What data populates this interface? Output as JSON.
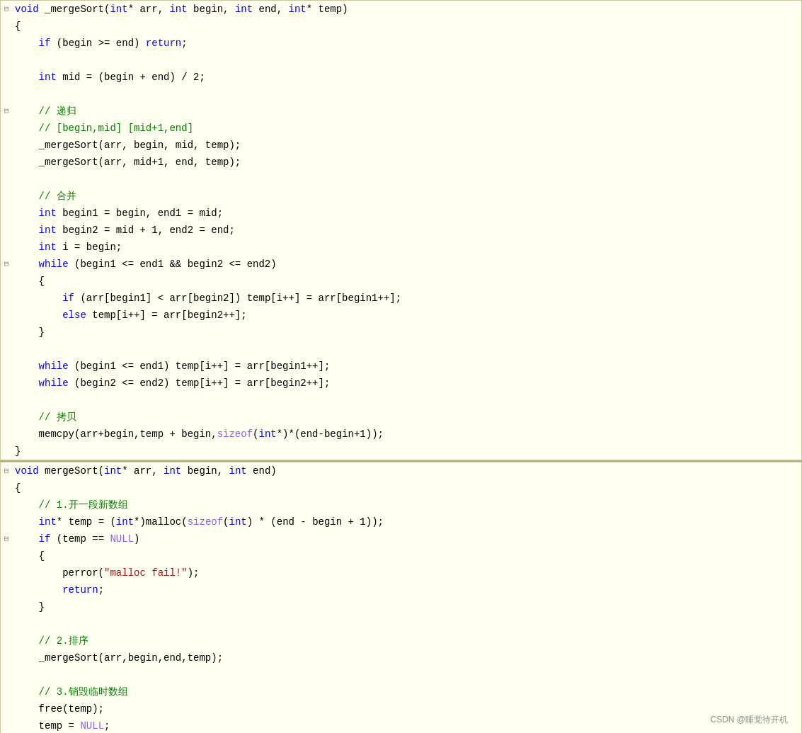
{
  "watermark": "CSDN @睡觉待开机",
  "blocks": [
    {
      "id": "block1",
      "lines": [
        {
          "fold": "⊟",
          "tokens": [
            {
              "t": "kw",
              "v": "void"
            },
            {
              "t": "plain",
              "v": " _mergeSort("
            },
            {
              "t": "kw",
              "v": "int"
            },
            {
              "t": "plain",
              "v": "* arr, "
            },
            {
              "t": "kw",
              "v": "int"
            },
            {
              "t": "plain",
              "v": " begin, "
            },
            {
              "t": "kw",
              "v": "int"
            },
            {
              "t": "plain",
              "v": " end, "
            },
            {
              "t": "kw",
              "v": "int"
            },
            {
              "t": "plain",
              "v": "* temp)"
            }
          ]
        },
        {
          "fold": "",
          "tokens": [
            {
              "t": "plain",
              "v": "{"
            }
          ]
        },
        {
          "fold": "",
          "tokens": [
            {
              "t": "plain",
              "v": "    "
            },
            {
              "t": "kw",
              "v": "if"
            },
            {
              "t": "plain",
              "v": " (begin >= end) "
            },
            {
              "t": "kw",
              "v": "return"
            },
            {
              "t": "plain",
              "v": ";"
            }
          ]
        },
        {
          "fold": "",
          "tokens": []
        },
        {
          "fold": "",
          "tokens": [
            {
              "t": "plain",
              "v": "    "
            },
            {
              "t": "kw",
              "v": "int"
            },
            {
              "t": "plain",
              "v": " mid = (begin + end) / 2;"
            }
          ]
        },
        {
          "fold": "",
          "tokens": []
        },
        {
          "fold": "⊟",
          "tokens": [
            {
              "t": "plain",
              "v": "    "
            },
            {
              "t": "cn",
              "v": "// 递归"
            }
          ]
        },
        {
          "fold": "",
          "tokens": [
            {
              "t": "plain",
              "v": "    "
            },
            {
              "t": "cn",
              "v": "// [begin,mid] [mid+1,end]"
            }
          ]
        },
        {
          "fold": "",
          "tokens": [
            {
              "t": "plain",
              "v": "    _mergeSort(arr, begin, mid, temp);"
            }
          ]
        },
        {
          "fold": "",
          "tokens": [
            {
              "t": "plain",
              "v": "    _mergeSort(arr, mid+1, end, temp);"
            }
          ]
        },
        {
          "fold": "",
          "tokens": []
        },
        {
          "fold": "",
          "tokens": [
            {
              "t": "plain",
              "v": "    "
            },
            {
              "t": "cn",
              "v": "// 合并"
            }
          ]
        },
        {
          "fold": "",
          "tokens": [
            {
              "t": "plain",
              "v": "    "
            },
            {
              "t": "kw",
              "v": "int"
            },
            {
              "t": "plain",
              "v": " begin1 = begin, end1 = mid;"
            }
          ]
        },
        {
          "fold": "",
          "tokens": [
            {
              "t": "plain",
              "v": "    "
            },
            {
              "t": "kw",
              "v": "int"
            },
            {
              "t": "plain",
              "v": " begin2 = mid + 1, end2 = end;"
            }
          ]
        },
        {
          "fold": "",
          "tokens": [
            {
              "t": "plain",
              "v": "    "
            },
            {
              "t": "kw",
              "v": "int"
            },
            {
              "t": "plain",
              "v": " i = begin;"
            }
          ]
        },
        {
          "fold": "⊟",
          "tokens": [
            {
              "t": "plain",
              "v": "    "
            },
            {
              "t": "kw",
              "v": "while"
            },
            {
              "t": "plain",
              "v": " (begin1 <= end1 && begin2 <= end2)"
            }
          ]
        },
        {
          "fold": "",
          "tokens": [
            {
              "t": "plain",
              "v": "    {"
            }
          ]
        },
        {
          "fold": "",
          "tokens": [
            {
              "t": "plain",
              "v": "        "
            },
            {
              "t": "kw",
              "v": "if"
            },
            {
              "t": "plain",
              "v": " (arr[begin1] < arr[begin2]) temp[i++] = arr[begin1++];"
            }
          ]
        },
        {
          "fold": "",
          "tokens": [
            {
              "t": "plain",
              "v": "        "
            },
            {
              "t": "kw",
              "v": "else"
            },
            {
              "t": "plain",
              "v": " temp[i++] = arr[begin2++];"
            }
          ]
        },
        {
          "fold": "",
          "tokens": [
            {
              "t": "plain",
              "v": "    }"
            }
          ]
        },
        {
          "fold": "",
          "tokens": []
        },
        {
          "fold": "",
          "tokens": [
            {
              "t": "plain",
              "v": "    "
            },
            {
              "t": "kw",
              "v": "while"
            },
            {
              "t": "plain",
              "v": " (begin1 <= end1) temp[i++] = arr[begin1++];"
            }
          ]
        },
        {
          "fold": "",
          "tokens": [
            {
              "t": "plain",
              "v": "    "
            },
            {
              "t": "kw",
              "v": "while"
            },
            {
              "t": "plain",
              "v": " (begin2 <= end2) temp[i++] = arr[begin2++];"
            }
          ]
        },
        {
          "fold": "",
          "tokens": []
        },
        {
          "fold": "",
          "tokens": [
            {
              "t": "plain",
              "v": "    "
            },
            {
              "t": "cn",
              "v": "// 拷贝"
            }
          ]
        },
        {
          "fold": "",
          "tokens": [
            {
              "t": "plain",
              "v": "    memcpy(arr+begin,temp + begin,"
            },
            {
              "t": "macro",
              "v": "sizeof"
            },
            {
              "t": "plain",
              "v": "("
            },
            {
              "t": "kw",
              "v": "int"
            },
            {
              "t": "plain",
              "v": "*)*(end-begin+1));"
            }
          ]
        },
        {
          "fold": "",
          "tokens": [
            {
              "t": "plain",
              "v": "}"
            }
          ]
        }
      ]
    },
    {
      "id": "block2",
      "lines": [
        {
          "fold": "⊟",
          "tokens": [
            {
              "t": "kw",
              "v": "void"
            },
            {
              "t": "plain",
              "v": " mergeSort("
            },
            {
              "t": "kw",
              "v": "int"
            },
            {
              "t": "plain",
              "v": "* arr, "
            },
            {
              "t": "kw",
              "v": "int"
            },
            {
              "t": "plain",
              "v": " begin, "
            },
            {
              "t": "kw",
              "v": "int"
            },
            {
              "t": "plain",
              "v": " end)"
            }
          ]
        },
        {
          "fold": "",
          "tokens": [
            {
              "t": "plain",
              "v": "{"
            }
          ]
        },
        {
          "fold": "",
          "tokens": [
            {
              "t": "plain",
              "v": "    "
            },
            {
              "t": "cn",
              "v": "// 1.开一段新数组"
            }
          ]
        },
        {
          "fold": "",
          "tokens": [
            {
              "t": "plain",
              "v": "    "
            },
            {
              "t": "kw",
              "v": "int"
            },
            {
              "t": "plain",
              "v": "* temp = ("
            },
            {
              "t": "kw",
              "v": "int"
            },
            {
              "t": "plain",
              "v": "*)malloc("
            },
            {
              "t": "macro",
              "v": "sizeof"
            },
            {
              "t": "plain",
              "v": "("
            },
            {
              "t": "kw",
              "v": "int"
            },
            {
              "t": "plain",
              "v": ") * (end - begin + 1));"
            }
          ]
        },
        {
          "fold": "⊟",
          "tokens": [
            {
              "t": "plain",
              "v": "    "
            },
            {
              "t": "kw",
              "v": "if"
            },
            {
              "t": "plain",
              "v": " (temp == "
            },
            {
              "t": "macro",
              "v": "NULL"
            },
            {
              "t": "plain",
              "v": ")"
            }
          ]
        },
        {
          "fold": "",
          "tokens": [
            {
              "t": "plain",
              "v": "    {"
            }
          ]
        },
        {
          "fold": "",
          "tokens": [
            {
              "t": "plain",
              "v": "        perror("
            },
            {
              "t": "str",
              "v": "\"malloc fail!\""
            },
            {
              "t": "plain",
              "v": ");"
            }
          ]
        },
        {
          "fold": "",
          "tokens": [
            {
              "t": "plain",
              "v": "        "
            },
            {
              "t": "kw",
              "v": "return"
            },
            {
              "t": "plain",
              "v": ";"
            }
          ]
        },
        {
          "fold": "",
          "tokens": [
            {
              "t": "plain",
              "v": "    }"
            }
          ]
        },
        {
          "fold": "",
          "tokens": []
        },
        {
          "fold": "",
          "tokens": [
            {
              "t": "plain",
              "v": "    "
            },
            {
              "t": "cn",
              "v": "// 2.排序"
            }
          ]
        },
        {
          "fold": "",
          "tokens": [
            {
              "t": "plain",
              "v": "    _mergeSort(arr,begin,end,temp);"
            }
          ]
        },
        {
          "fold": "",
          "tokens": []
        },
        {
          "fold": "",
          "tokens": [
            {
              "t": "plain",
              "v": "    "
            },
            {
              "t": "cn",
              "v": "// 3.销毁临时数组"
            }
          ]
        },
        {
          "fold": "",
          "tokens": [
            {
              "t": "plain",
              "v": "    free(temp);"
            }
          ]
        },
        {
          "fold": "",
          "tokens": [
            {
              "t": "plain",
              "v": "    temp = "
            },
            {
              "t": "macro",
              "v": "NULL"
            },
            {
              "t": "plain",
              "v": ";"
            }
          ]
        },
        {
          "fold": "",
          "tokens": [
            {
              "t": "plain",
              "v": "}"
            }
          ]
        }
      ]
    }
  ]
}
